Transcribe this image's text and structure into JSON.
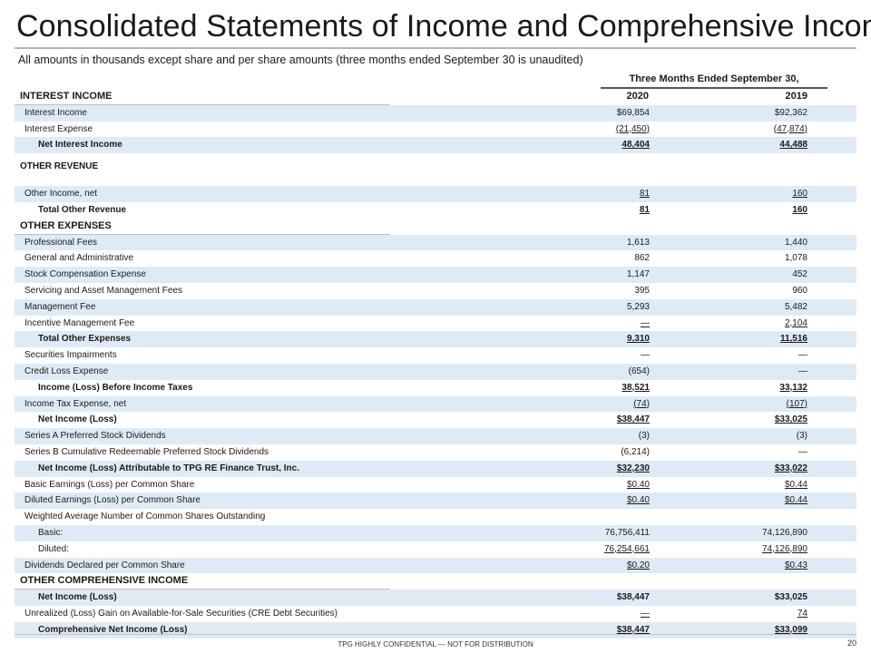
{
  "title": "Consolidated Statements of Income and Comprehensive Income",
  "subtitle": "All amounts in thousands except share and per share amounts (three months ended September 30 is unaudited)",
  "period_header": "Three Months Ended September 30,",
  "years": [
    "2020",
    "2019"
  ],
  "sections": {
    "interest_income": "INTEREST INCOME",
    "other_revenue": "OTHER REVENUE",
    "other_expenses": "OTHER EXPENSES",
    "other_comprehensive_income": "OTHER COMPREHENSIVE INCOME"
  },
  "rows": {
    "interest_income": {
      "label": "Interest Income",
      "v2020": "$69,854",
      "v2019": "$92,362"
    },
    "interest_expense": {
      "label": "Interest Expense",
      "v2020": "(21,450)",
      "v2019": "(47,874)"
    },
    "net_interest_income": {
      "label": "Net Interest Income",
      "v2020": "48,404",
      "v2019": "44,488"
    },
    "other_income_net": {
      "label": "Other Income, net",
      "v2020": "81",
      "v2019": "160"
    },
    "total_other_revenue": {
      "label": "Total Other Revenue",
      "v2020": "81",
      "v2019": "160"
    },
    "professional_fees": {
      "label": "Professional Fees",
      "v2020": "1,613",
      "v2019": "1,440"
    },
    "general_admin": {
      "label": "General and Administrative",
      "v2020": "862",
      "v2019": "1,078"
    },
    "stock_comp": {
      "label": "Stock Compensation Expense",
      "v2020": "1,147",
      "v2019": "452"
    },
    "servicing_fees": {
      "label": "Servicing and Asset Management Fees",
      "v2020": "395",
      "v2019": "960"
    },
    "management_fee": {
      "label": "Management Fee",
      "v2020": "5,293",
      "v2019": "5,482"
    },
    "incentive_fee": {
      "label": "Incentive Management Fee",
      "v2020": "—",
      "v2019": "2,104"
    },
    "total_other_expenses": {
      "label": "Total Other Expenses",
      "v2020": "9,310",
      "v2019": "11,516"
    },
    "securities_impairments": {
      "label": "Securities Impairments",
      "v2020": "—",
      "v2019": "—"
    },
    "credit_loss": {
      "label": "Credit Loss Expense",
      "v2020": "(654)",
      "v2019": "—"
    },
    "income_before_tax": {
      "label": "Income (Loss) Before Income Taxes",
      "v2020": "38,521",
      "v2019": "33,132"
    },
    "income_tax": {
      "label": "Income Tax Expense, net",
      "v2020": "(74)",
      "v2019": "(107)"
    },
    "net_income": {
      "label": "Net Income (Loss)",
      "v2020": "$38,447",
      "v2019": "$33,025"
    },
    "series_a": {
      "label": "Series A Preferred Stock Dividends",
      "v2020": "(3)",
      "v2019": "(3)"
    },
    "series_b": {
      "label": "Series B Cumulative Redeemable Preferred Stock Dividends",
      "v2020": "(6,214)",
      "v2019": "—"
    },
    "net_income_tpg": {
      "label": "Net Income (Loss) Attributable to TPG RE Finance Trust, Inc.",
      "v2020": "$32,230",
      "v2019": "$33,022"
    },
    "basic_eps": {
      "label": "Basic Earnings (Loss) per Common Share",
      "v2020": "$0.40",
      "v2019": "$0.44"
    },
    "diluted_eps": {
      "label": "Diluted Earnings (Loss) per Common Share",
      "v2020": "$0.40",
      "v2019": "$0.44"
    },
    "weighted_avg": {
      "label": "Weighted Average Number of Common Shares Outstanding"
    },
    "basic_shares": {
      "label": "Basic:",
      "v2020": "76,756,411",
      "v2019": "74,126,890"
    },
    "diluted_shares": {
      "label": "Diluted:",
      "v2020": "76,254,661",
      "v2019": "74,126,890"
    },
    "dividends": {
      "label": "Dividends Declared per Common Share",
      "v2020": "$0.20",
      "v2019": "$0.43"
    },
    "oci_net_income": {
      "label": "Net Income (Loss)",
      "v2020": "$38,447",
      "v2019": "$33,025"
    },
    "unrealized_gain": {
      "label": "Unrealized (Loss) Gain on Available-for-Sale Securities (CRE Debt Securities)",
      "v2020": "—",
      "v2019": "74"
    },
    "comprehensive_net_income": {
      "label": "Comprehensive Net Income (Loss)",
      "v2020": "$38,447",
      "v2019": "$33,099"
    }
  },
  "footer": "TPG HIGHLY CONFIDENTIAL — NOT FOR DISTRIBUTION",
  "page_number": "20",
  "colors": {
    "row_shade": "#deebf7",
    "rule": "#bfbfbf"
  }
}
